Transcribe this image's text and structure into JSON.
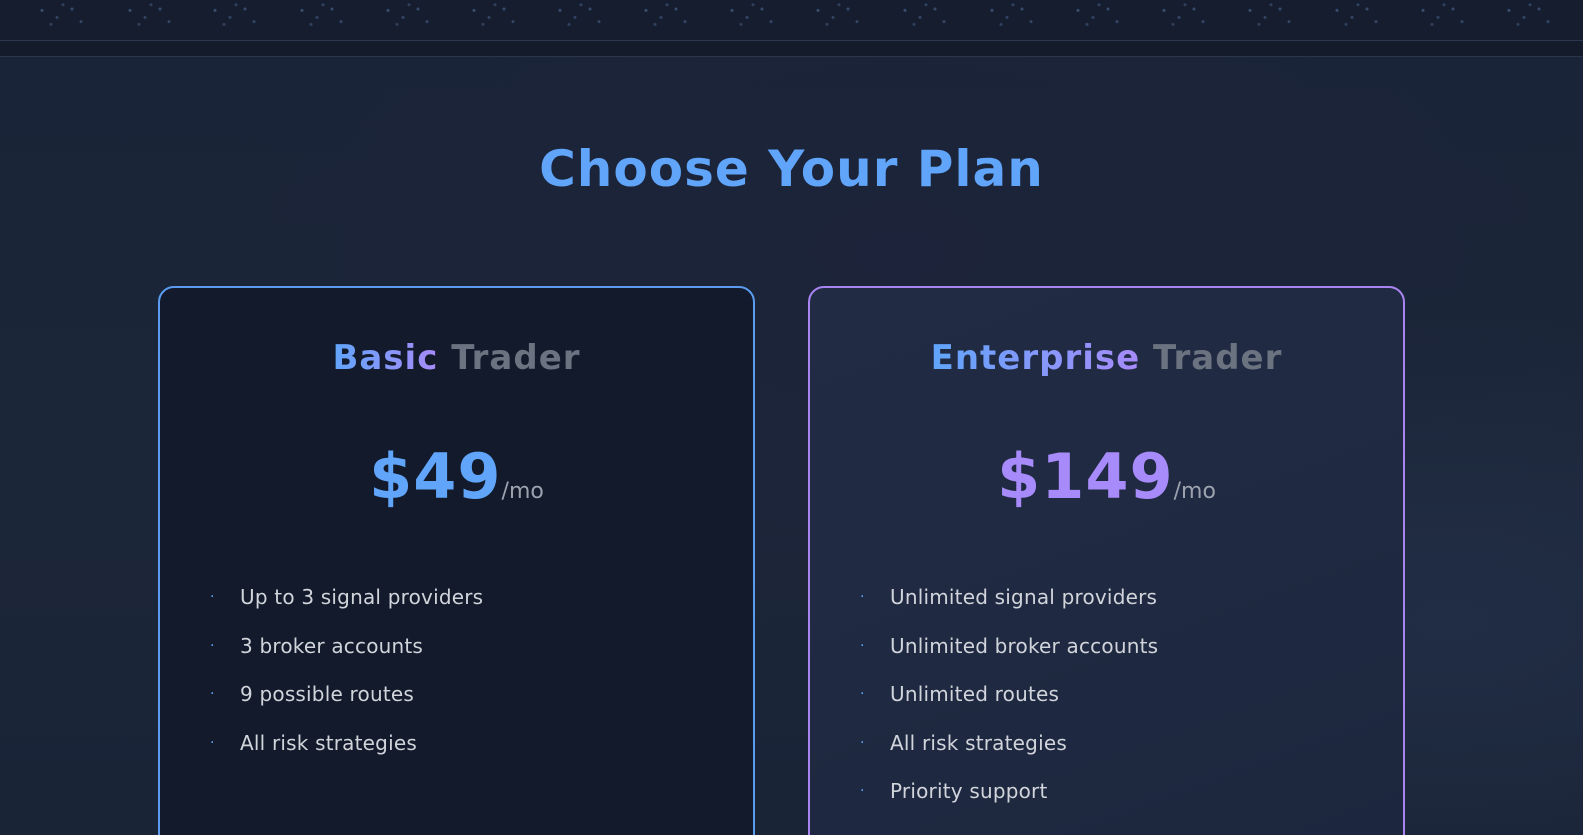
{
  "section": {
    "title": "Choose Your Plan"
  },
  "plans": [
    {
      "tier": "Basic",
      "suffix": "Trader",
      "price": "$49",
      "period": "/mo",
      "features": [
        "Up to 3 signal providers",
        "3 broker accounts",
        "9 possible routes",
        "All risk strategies"
      ]
    },
    {
      "tier": "Enterprise",
      "suffix": "Trader",
      "price": "$149",
      "period": "/mo",
      "features": [
        "Unlimited signal providers",
        "Unlimited broker accounts",
        "Unlimited routes",
        "All risk strategies",
        "Priority support"
      ]
    }
  ],
  "bullet_glyph": "·",
  "colors": {
    "accent_blue": "#60a5fa",
    "accent_purple": "#a78bfa",
    "muted": "#6b7280",
    "background": "#1b2538"
  }
}
